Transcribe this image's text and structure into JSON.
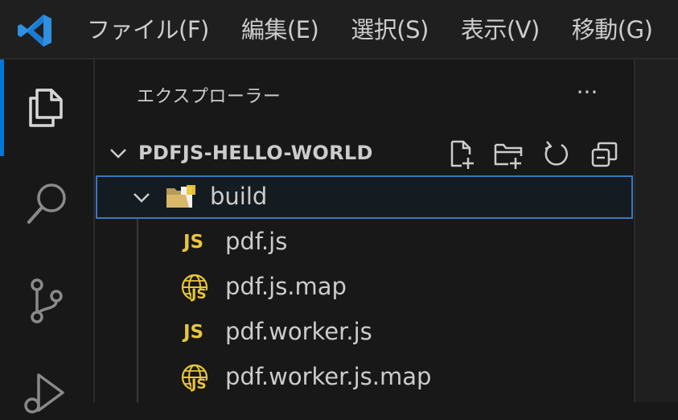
{
  "menubar": {
    "items": [
      "ファイル(F)",
      "編集(E)",
      "選択(S)",
      "表示(V)",
      "移動(G)"
    ]
  },
  "activity_bar": {
    "items": [
      {
        "icon": "explorer-icon",
        "active": true
      },
      {
        "icon": "search-icon",
        "active": false
      },
      {
        "icon": "source-control-icon",
        "active": false
      },
      {
        "icon": "run-debug-icon",
        "active": false
      }
    ]
  },
  "explorer": {
    "title": "エクスプローラー",
    "more_label": "···",
    "workspace_folder": "PDFJS-HELLO-WORLD",
    "tree": [
      {
        "label": "build",
        "type": "folder",
        "expanded": true,
        "selected": true
      },
      {
        "label": "pdf.js",
        "type": "js",
        "badge": "JS"
      },
      {
        "label": "pdf.js.map",
        "type": "map",
        "badge": "JS"
      },
      {
        "label": "pdf.worker.js",
        "type": "js",
        "badge": "JS"
      },
      {
        "label": "pdf.worker.js.map",
        "type": "map",
        "badge": "JS"
      }
    ]
  },
  "colors": {
    "accent": "#0078d4",
    "js_badge": "#e8c63b",
    "selection_border": "#3a76c4",
    "text": "#cccccc"
  }
}
